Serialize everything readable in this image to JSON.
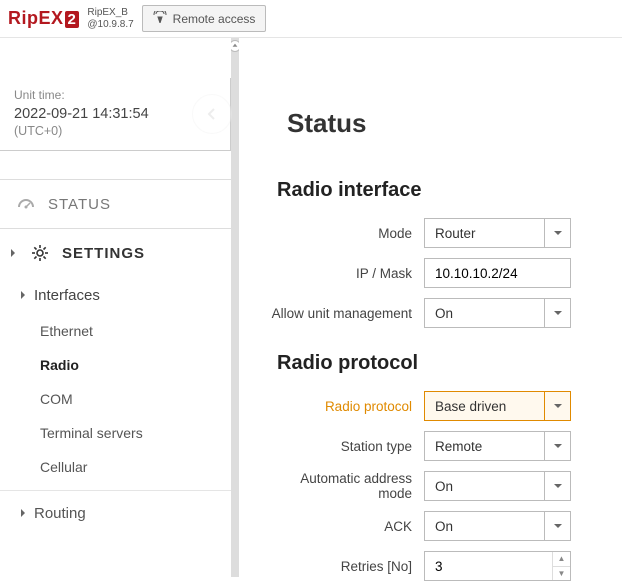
{
  "header": {
    "logo_main": "RipE",
    "logo_x": "X",
    "logo_two": "2",
    "device_name": "RipEX_B",
    "device_ip": "@10.9.8.7",
    "remote_access": "Remote access"
  },
  "time": {
    "label": "Unit time:",
    "value": "2022-09-21 14:31:54",
    "tz": "(UTC+0)"
  },
  "nav": {
    "status": "STATUS",
    "settings": "SETTINGS",
    "interfaces_group": "Interfaces",
    "items": {
      "ethernet": "Ethernet",
      "radio": "Radio",
      "com": "COM",
      "terminal_servers": "Terminal servers",
      "cellular": "Cellular"
    },
    "routing_group": "Routing"
  },
  "page": {
    "title": "Status",
    "radio_interface": {
      "heading": "Radio interface",
      "mode_label": "Mode",
      "mode_value": "Router",
      "ipmask_label": "IP / Mask",
      "ipmask_value": "10.10.10.2/24",
      "allow_label": "Allow unit management",
      "allow_value": "On"
    },
    "radio_protocol": {
      "heading": "Radio protocol",
      "protocol_label": "Radio protocol",
      "protocol_value": "Base driven",
      "station_label": "Station type",
      "station_value": "Remote",
      "auto_label": "Automatic address mode",
      "auto_value": "On",
      "ack_label": "ACK",
      "ack_value": "On",
      "retries_label": "Retries [No]",
      "retries_value": "3"
    }
  }
}
